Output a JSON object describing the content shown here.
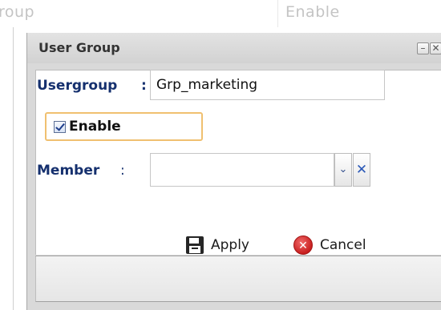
{
  "background_table": {
    "columns": [
      "roup",
      "Enable"
    ]
  },
  "dialog": {
    "title": "User Group",
    "minimize_glyph": "–",
    "close_glyph": "✕"
  },
  "form": {
    "usergroup": {
      "label": "Usergroup",
      "colon": ":",
      "value": "Grp_marketing"
    },
    "enable": {
      "label": "Enable",
      "checked": true
    },
    "member": {
      "label": "Member",
      "colon": ":",
      "value": "",
      "dropdown_glyph": "⌄",
      "clear_glyph": "✕"
    }
  },
  "footer": {
    "apply_label": "Apply",
    "cancel_label": "Cancel",
    "cancel_glyph": "✕"
  },
  "icons": {
    "apply": "floppy-disk-icon",
    "cancel": "cancel-circle-icon",
    "minimize": "minimize-icon",
    "close": "close-icon",
    "dropdown": "chevron-down-icon",
    "clear": "clear-icon"
  },
  "colors": {
    "label_text": "#15306e",
    "enable_highlight": "#f0c070",
    "cancel_red": "#c81f1f"
  }
}
